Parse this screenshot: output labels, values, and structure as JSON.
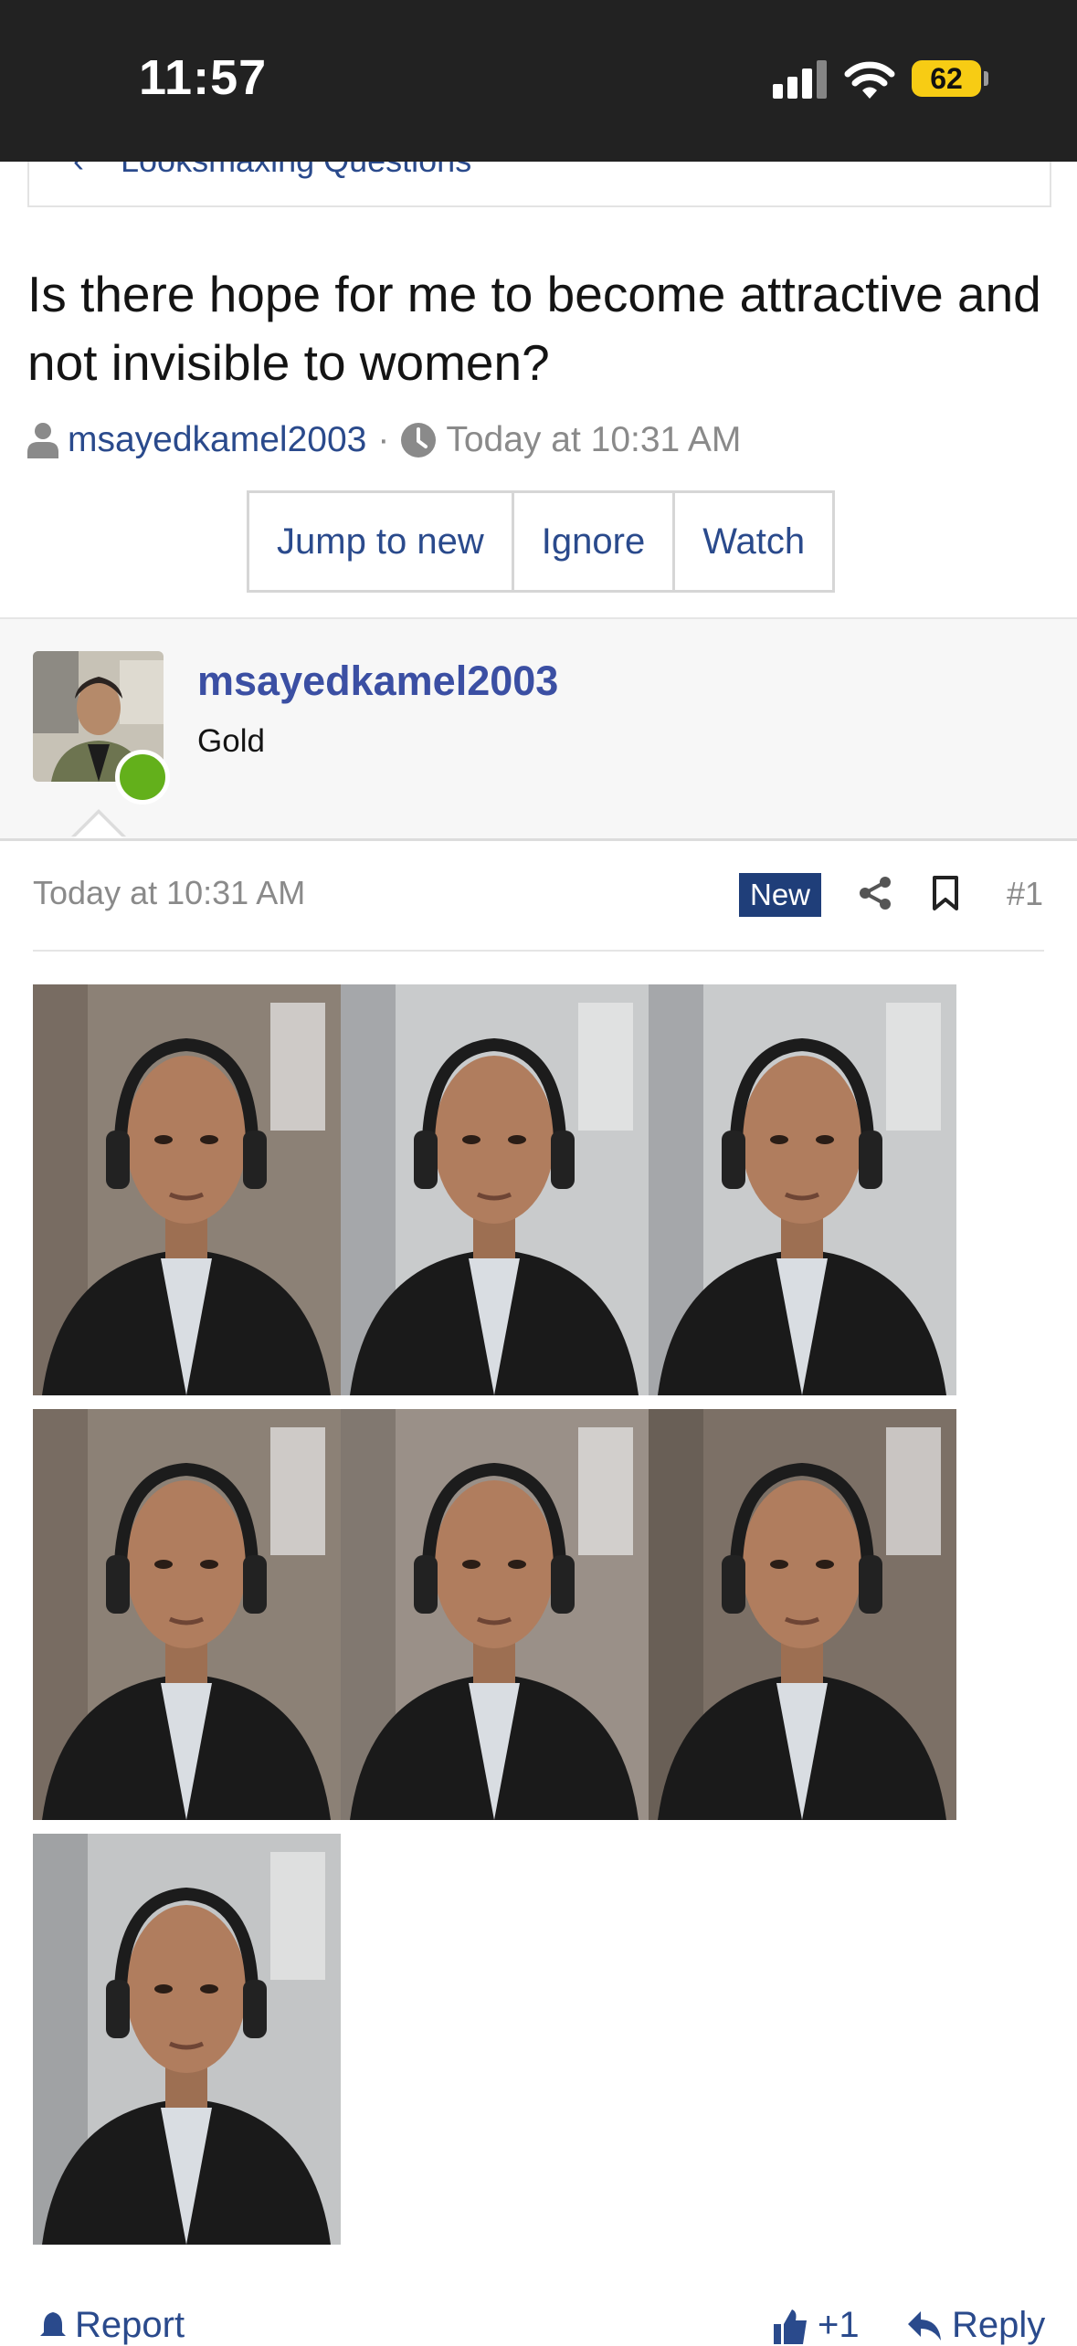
{
  "status": {
    "time": "11:57",
    "battery": "62"
  },
  "breadcrumb": {
    "label": "Looksmaxing Questions"
  },
  "thread": {
    "title": "Is there hope for me to become attractive and not invisible to women?",
    "author": "msayedkamel2003",
    "separator": "·",
    "date": "Today at 10:31 AM"
  },
  "actions": {
    "jump_to_new": "Jump to new",
    "ignore": "Ignore",
    "watch": "Watch"
  },
  "post": {
    "username": "msayedkamel2003",
    "user_title": "Gold",
    "date": "Today at 10:31 AM",
    "badge": "New",
    "number": "#1",
    "photos": [
      {
        "bg": "#8c8176",
        "shade": "#6b5f55"
      },
      {
        "bg": "#c9cbcc",
        "shade": "#8d9092"
      },
      {
        "bg": "#c9cbcc",
        "shade": "#8d9092"
      },
      {
        "bg": "#8c8176",
        "shade": "#6b5f55"
      },
      {
        "bg": "#9a9088",
        "shade": "#716960"
      },
      {
        "bg": "#7c7066",
        "shade": "#5e544b"
      },
      {
        "bg": "#c3c5c6",
        "shade": "#888b8d"
      }
    ]
  },
  "footer": {
    "report": "Report",
    "like": "+1",
    "reply": "Reply"
  },
  "colors": {
    "link": "#2a4a8c",
    "username": "#3b4fa3",
    "badge": "#1f3e79",
    "online": "#63b01b"
  }
}
